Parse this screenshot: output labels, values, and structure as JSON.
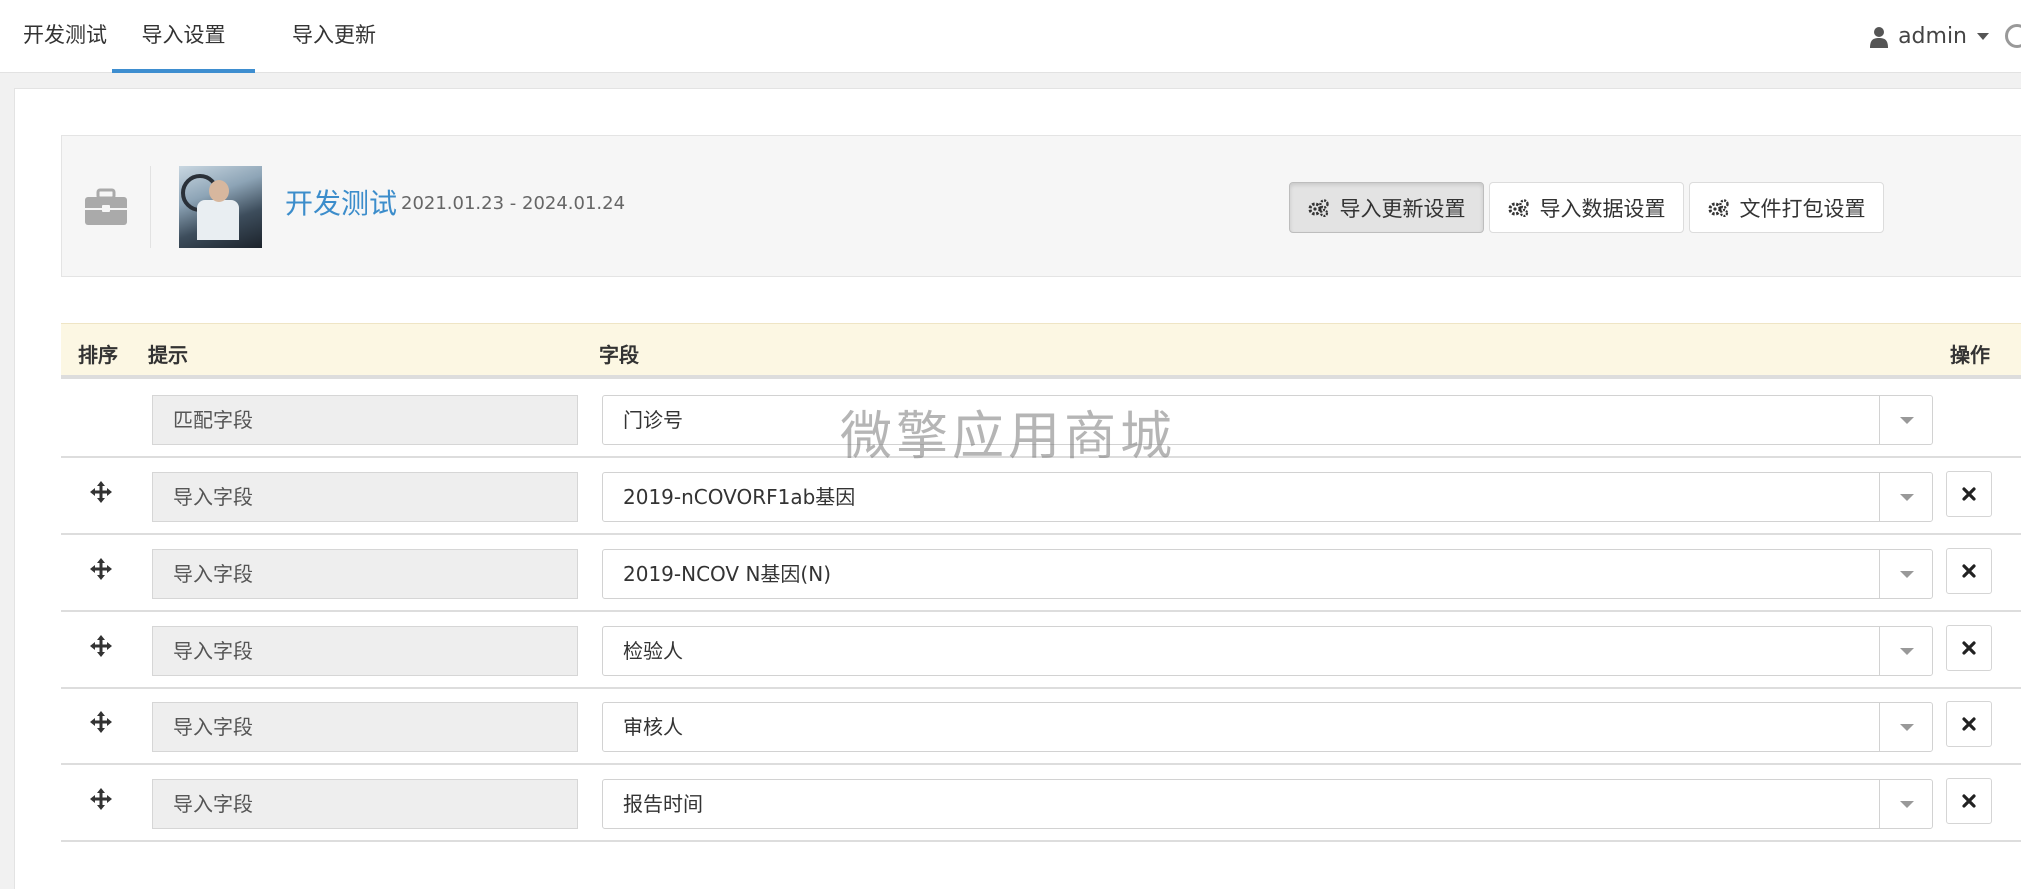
{
  "nav": {
    "tabs": [
      {
        "label": "开发测试"
      },
      {
        "label": "导入设置",
        "active": true
      },
      {
        "label": "导入更新"
      }
    ],
    "user": {
      "name": "admin",
      "icon": "user-icon"
    }
  },
  "project": {
    "title": "开发测试",
    "dates": "2021.01.23 - 2024.01.24",
    "buttons": [
      {
        "label": "导入更新设置",
        "icon": "gears-icon",
        "active": true
      },
      {
        "label": "导入数据设置",
        "icon": "gears-icon"
      },
      {
        "label": "文件打包设置",
        "icon": "gears-icon"
      }
    ]
  },
  "table": {
    "headers": {
      "sort": "排序",
      "tip": "提示",
      "field": "字段",
      "action": "操作"
    },
    "rows": [
      {
        "tip": "匹配字段",
        "field": "门诊号"
      },
      {
        "tip": "导入字段",
        "field": "2019-nCOVORF1ab基因"
      },
      {
        "tip": "导入字段",
        "field": "2019-NCOV N基因(N)"
      },
      {
        "tip": "导入字段",
        "field": "检验人"
      },
      {
        "tip": "导入字段",
        "field": "审核人"
      },
      {
        "tip": "导入字段",
        "field": "报告时间"
      }
    ]
  },
  "watermark": "微擎应用商城",
  "colors": {
    "accent": "#3e8ed0",
    "header_bg": "#fcf7e3",
    "title": "#3c8dcb"
  }
}
